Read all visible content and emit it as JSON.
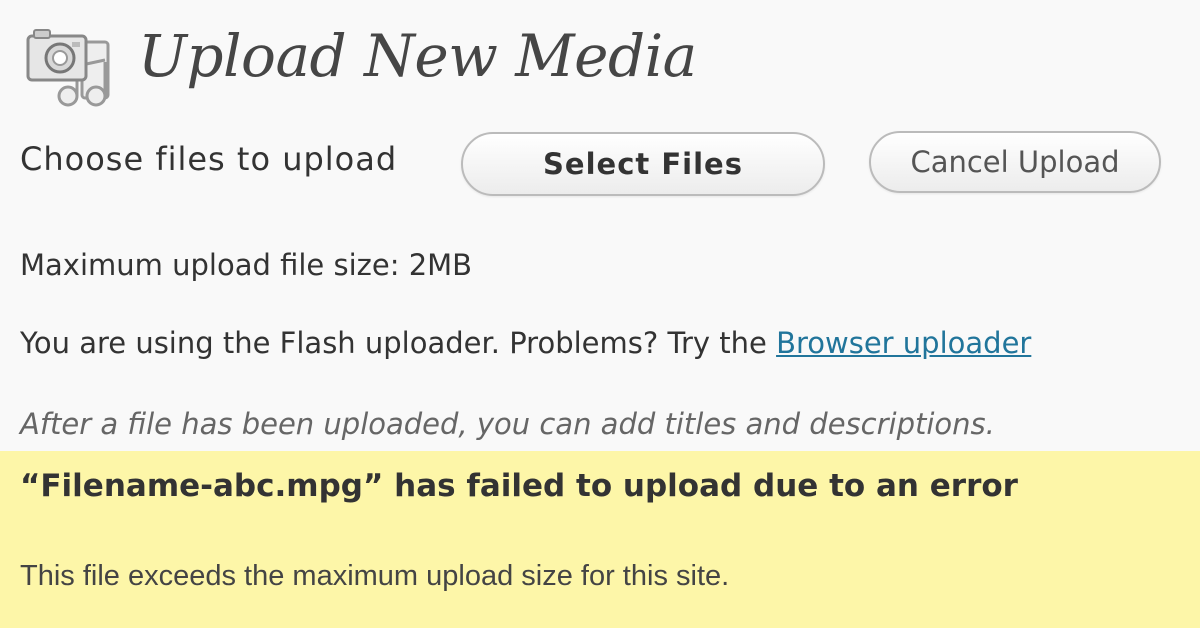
{
  "header": {
    "icon": "media-upload-icon",
    "title": "Upload New Media"
  },
  "uploader": {
    "choose_label": "Choose files to upload",
    "select_button": "Select Files",
    "cancel_button": "Cancel Upload"
  },
  "info": {
    "max_size": "Maximum upload file size: 2MB",
    "flash_text": "You are using the Flash uploader. Problems? Try the ",
    "flash_link": "Browser uploader",
    "hint": "After a file has been uploaded, you can add titles and descriptions."
  },
  "error": {
    "title": "“Filename-abc.mpg” has failed to upload due to an error",
    "detail": "This file exceeds the maximum upload size for this site.",
    "background": "#fdf6a8"
  },
  "colors": {
    "link": "#21759b",
    "title": "#464646"
  }
}
